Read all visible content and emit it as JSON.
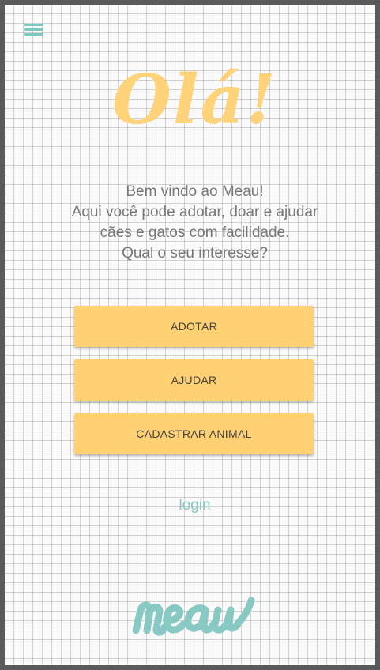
{
  "header": {
    "menu_icon": "hamburger-menu-icon"
  },
  "greeting": "Olá!",
  "intro": {
    "lines": [
      "Bem vindo ao Meau!",
      "Aqui você pode adotar, doar e ajudar",
      "cães e gatos com facilidade.",
      "Qual o seu interesse?"
    ]
  },
  "actions": {
    "adotar": "ADOTAR",
    "ajudar": "AJUDAR",
    "cadastrar": "CADASTRAR ANIMAL"
  },
  "login": "login",
  "brand": {
    "logo_text": "meau",
    "logo_color": "#88c9c4"
  },
  "colors": {
    "accent_yellow": "#ffd173",
    "greeting_yellow": "#ffd37a",
    "teal": "#88c9c4",
    "text_gray": "#777777"
  }
}
